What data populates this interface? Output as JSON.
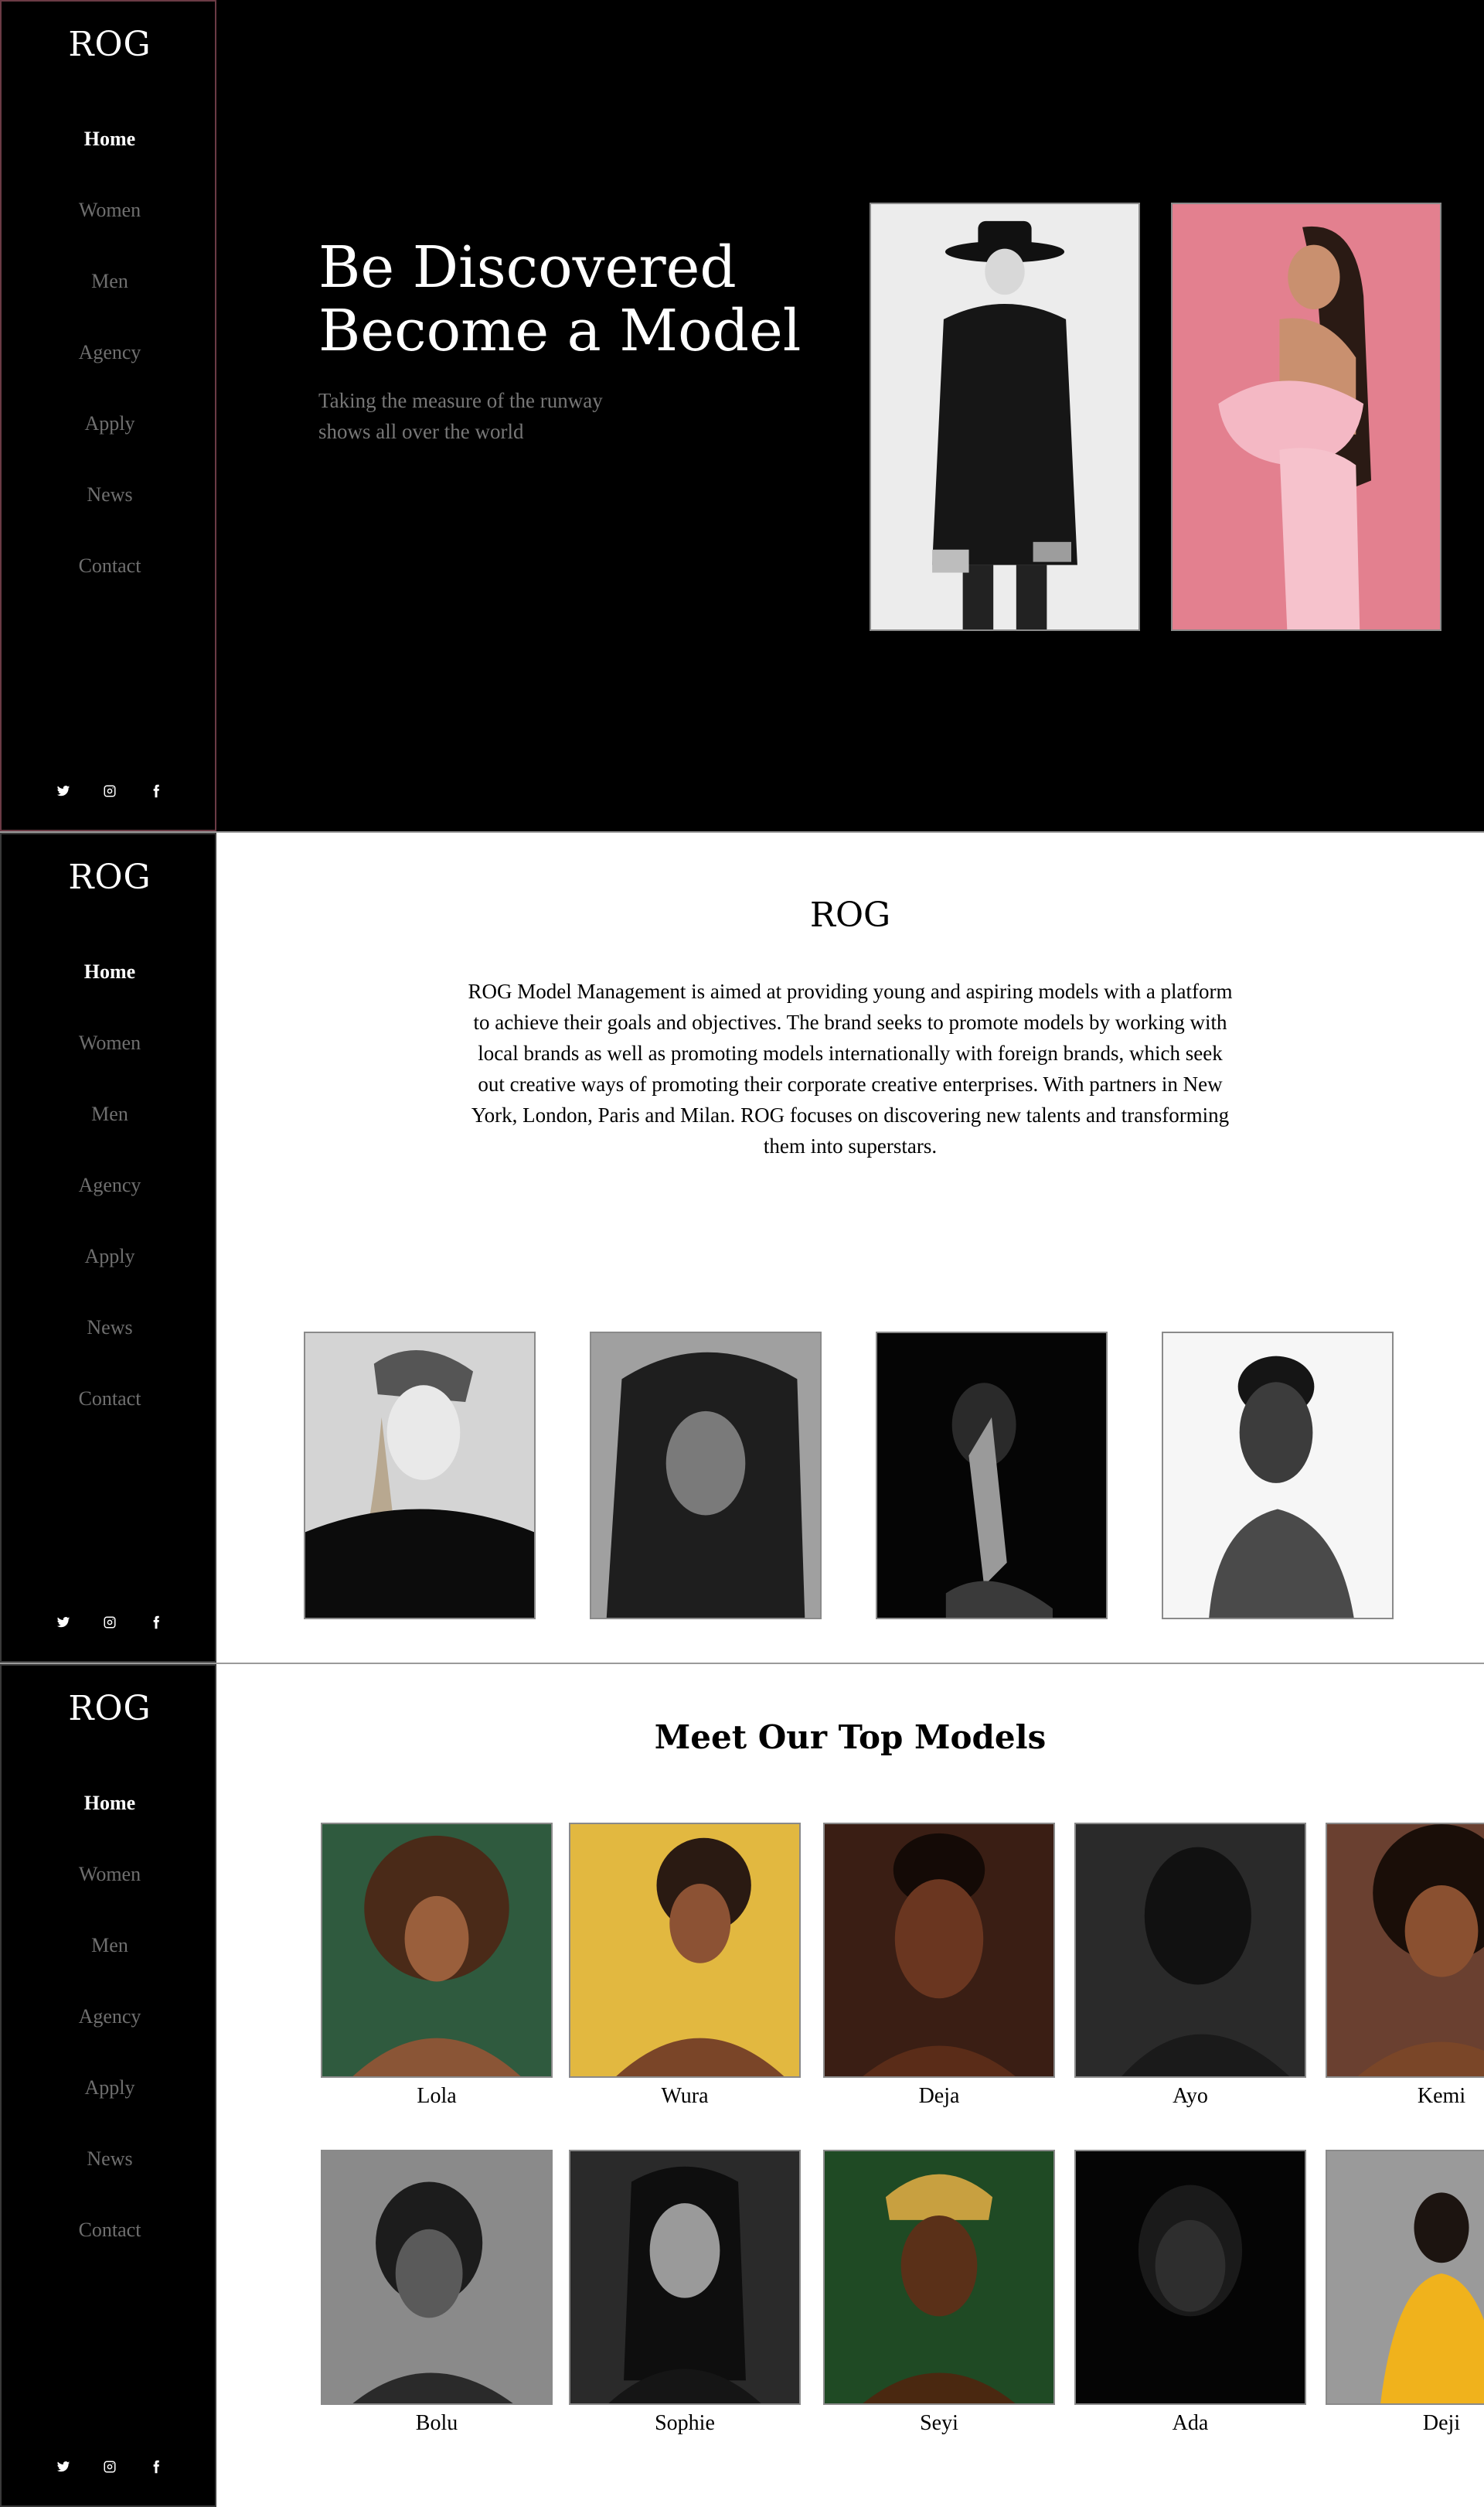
{
  "brand": {
    "logo": "ROG"
  },
  "nav": [
    "Home",
    "Women",
    "Men",
    "Agency",
    "Apply",
    "News",
    "Contact"
  ],
  "social": [
    "twitter-icon",
    "instagram-icon",
    "facebook-icon"
  ],
  "hero": {
    "title_line1": "Be Discovered",
    "title_line2": "Become a Model",
    "subtitle": "Taking the measure of the runway shows all over the world"
  },
  "about": {
    "title": "ROG",
    "text": "ROG Model Management is aimed at providing young and aspiring models with a platform to achieve their goals and objectives. The brand seeks to promote models by working with local brands as well as promoting models internationally with foreign brands, which seek out creative ways of promoting their corporate creative enterprises. With partners in New York, London, Paris and Milan. ROG focuses on discovering new talents and transforming them into superstars."
  },
  "models": {
    "title": "Meet Our Top Models",
    "row1": [
      "Lola",
      "Wura",
      "Deja",
      "Ayo",
      "Kemi"
    ],
    "row2": [
      "Bolu",
      "Sophie",
      "Seyi",
      "Ada",
      "Deji"
    ]
  },
  "colors": {
    "sidebar_bg": "#000000",
    "nav_active": "#ffffff",
    "nav_inactive": "#6f6f6f",
    "hero_bg": "#000000",
    "accent_border": "#6b3b45"
  }
}
